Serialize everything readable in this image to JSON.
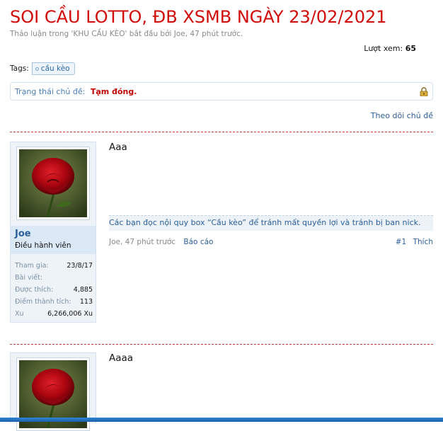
{
  "thread": {
    "title": "SOI CẦU LOTTO, ĐB XSMB NGÀY 23/02/2021",
    "description": "Thảo luận trong 'KHU CẦU KÈO' bắt đầu bởi Joe, 47 phút trước.",
    "views_label": "Lượt xem:",
    "views_value": "65",
    "tags_label": "Tags:",
    "tag": "cầu kèo",
    "status_label": "Trạng thái chủ đề:",
    "status_value": "Tạm đóng.",
    "follow_label": "Theo dõi chủ đề"
  },
  "posts": [
    {
      "message": "Aaa",
      "user": {
        "name": "Joe",
        "role": "Điều hành viên",
        "stats": [
          {
            "label": "Tham gia:",
            "value": "23/8/17"
          },
          {
            "label": "Bài viết:",
            "value": ""
          },
          {
            "label": "Được thích:",
            "value": "4,885"
          },
          {
            "label": "Điểm thành tích:",
            "value": "113"
          },
          {
            "label": "Xu",
            "value": "6,266,006 Xu"
          }
        ]
      },
      "signature": "Các bạn đọc nội quy box “Cầu kèo” để tránh mất quyền lợi và tránh bị ban nick.",
      "meta": "Joe, 47 phút trước",
      "report_label": "Báo cáo",
      "number": "#1",
      "like_label": "Thích"
    },
    {
      "message": "Aaaa"
    }
  ],
  "colors": {
    "title": "#d10a0a",
    "link": "#2b5f9a",
    "separator": "#c83a3a"
  }
}
